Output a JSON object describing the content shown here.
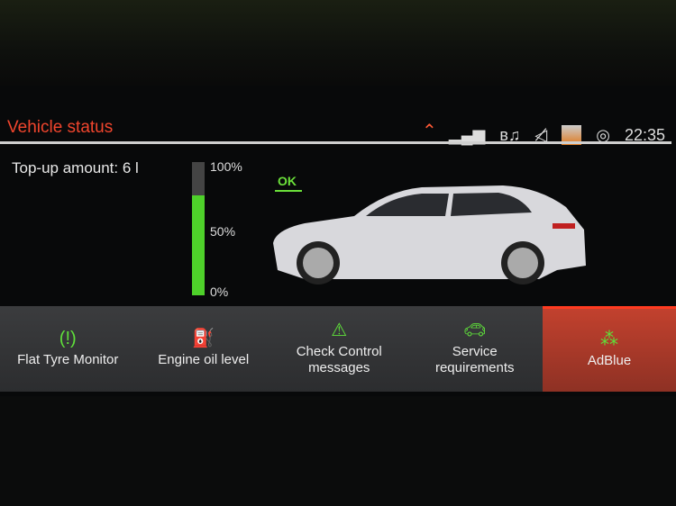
{
  "header": {
    "title": "Vehicle status",
    "time": "22:35",
    "icons": [
      "chevron-up-icon",
      "signal-icon",
      "bluetooth-audio-icon",
      "mute-icon",
      "user-avatar",
      "privacy-icon"
    ]
  },
  "oil": {
    "topup_label": "Top-up amount: 6 l",
    "level_percent": 75,
    "ticks": [
      "100%",
      "50%",
      "0%"
    ],
    "status": "OK"
  },
  "tabs": [
    {
      "label": "Flat Tyre Monitor",
      "icon": "tyre-pressure-icon"
    },
    {
      "label": "Engine oil level",
      "icon": "oil-can-icon"
    },
    {
      "label": "Check Control messages",
      "icon": "warning-triangle-icon"
    },
    {
      "label": "Service requirements",
      "icon": "car-service-icon"
    },
    {
      "label": "AdBlue",
      "icon": "adblue-icon",
      "selected": true
    }
  ],
  "colors": {
    "accent": "#f0452d",
    "ok": "#5fe03a"
  }
}
